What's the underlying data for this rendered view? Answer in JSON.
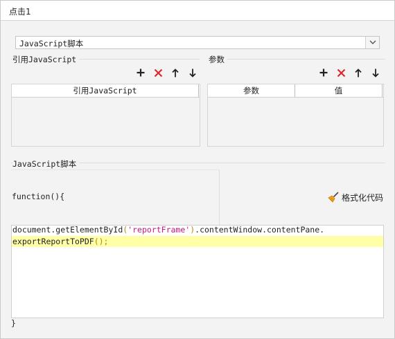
{
  "window": {
    "title": "点击1"
  },
  "script_type_select": {
    "value": "JavaScript脚本"
  },
  "references": {
    "label": "引用JavaScript",
    "columns": [
      "引用JavaScript"
    ],
    "rows": []
  },
  "params": {
    "label": "参数",
    "columns": [
      "参数",
      "值"
    ],
    "rows": []
  },
  "toolbar_icons": [
    "plus-icon",
    "delete-x-icon",
    "arrow-up-icon",
    "arrow-down-icon"
  ],
  "script_section": {
    "label": "JavaScript脚本",
    "function_header": "function(){",
    "format_button_label": "格式化代码",
    "code_line1": "document.getElementById('reportFrame').contentWindow.contentPane.",
    "code_line2": "exportReportToPDF();",
    "code_line1_parts": [
      "document.getElementById",
      "(",
      "'reportFrame'",
      ")",
      ".contentWindow.contentPane."
    ],
    "code_line2_parts": [
      "exportReportToPDF",
      "();"
    ],
    "closing_brace": "}"
  },
  "colors": {
    "delete_red": "#e0262c",
    "highlight": "#ffffa8",
    "string": "#c41a7f"
  }
}
